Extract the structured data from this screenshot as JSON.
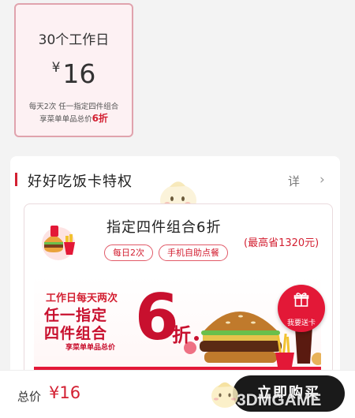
{
  "plan": {
    "title": "30个工作日",
    "currency": "¥",
    "price": "16",
    "desc_line1": "每天2次 任一指定四件组合",
    "desc_line2_prefix": "享菜单单品总价",
    "desc_line2_highlight": "6折"
  },
  "privilege": {
    "title": "好好吃饭卡特权",
    "detail_label": "详",
    "detail_chevron": "›",
    "combo_title": "指定四件组合6折",
    "save_text": "(最高省1320元)",
    "tags": [
      "每日2次",
      "手机自助点餐"
    ]
  },
  "banner": {
    "line1": "工作日每天两次",
    "line2": "任一指定",
    "line3": "四件组合",
    "line4": "享菜单单品总价",
    "big_number": "6",
    "zhe": "折"
  },
  "gift": {
    "label": "我要送卡",
    "icon": "gift-icon"
  },
  "footer": {
    "total_label": "总价",
    "total_value": "¥16",
    "buy_label": "立即购买"
  },
  "watermark": {
    "text": "3DMGAME"
  },
  "colors": {
    "accent": "#d32032",
    "plan_bg": "#fdf1f3",
    "plan_border": "#e0a3ad",
    "button_bg": "#1a1a1a"
  }
}
